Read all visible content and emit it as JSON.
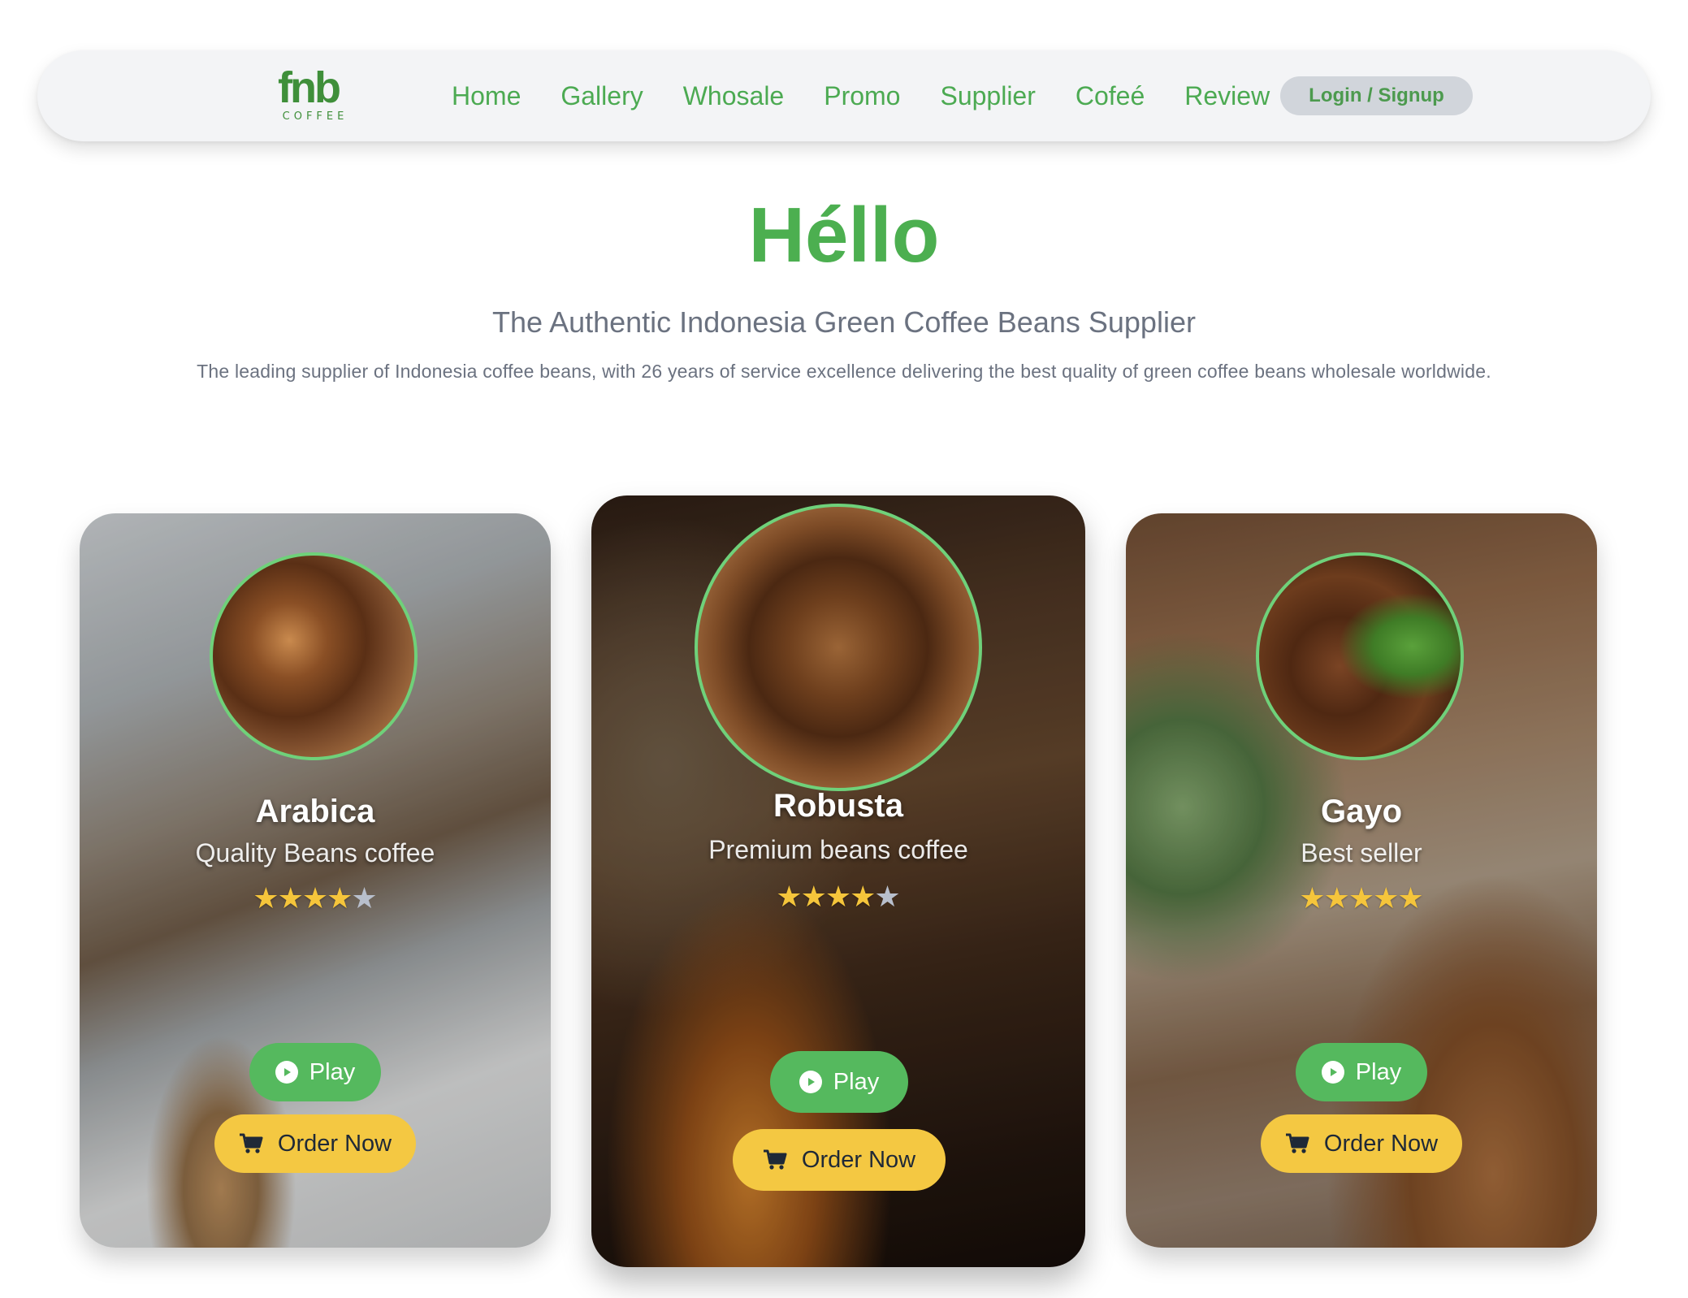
{
  "brand": {
    "logo_mark": "fnb",
    "logo_sub": "COFFEE"
  },
  "nav": {
    "items": [
      {
        "label": "Home"
      },
      {
        "label": "Gallery"
      },
      {
        "label": "Whosale"
      },
      {
        "label": "Promo"
      },
      {
        "label": "Supplier"
      },
      {
        "label": "Cofeé"
      },
      {
        "label": "Review"
      }
    ],
    "login_label": "Login / Signup"
  },
  "hero": {
    "title": "Héllo",
    "subtitle": "The Authentic Indonesia Green Coffee Beans Supplier",
    "description": "The leading supplier of Indonesia coffee beans, with 26 years of service excellence delivering the best quality of green coffee beans wholesale worldwide."
  },
  "cards": [
    {
      "name": "Arabica",
      "tagline": "Quality Beans coffee",
      "rating": 4,
      "max_rating": 5,
      "play_label": "Play",
      "order_label": "Order Now"
    },
    {
      "name": "Robusta",
      "tagline": "Premium beans coffee",
      "rating": 4,
      "max_rating": 5,
      "play_label": "Play",
      "order_label": "Order Now"
    },
    {
      "name": "Gayo",
      "tagline": "Best seller",
      "rating": 5,
      "max_rating": 5,
      "play_label": "Play",
      "order_label": "Order Now"
    }
  ],
  "colors": {
    "accent_green": "#4caf50",
    "nav_bg": "#f3f4f6",
    "login_bg": "#d1d5db",
    "play_bg": "#55b95e",
    "order_bg": "#f4c842",
    "star": "#f5c53b"
  },
  "icons": {
    "play": "play-circle-icon",
    "order": "shopping-cart-icon",
    "star": "star-icon"
  }
}
